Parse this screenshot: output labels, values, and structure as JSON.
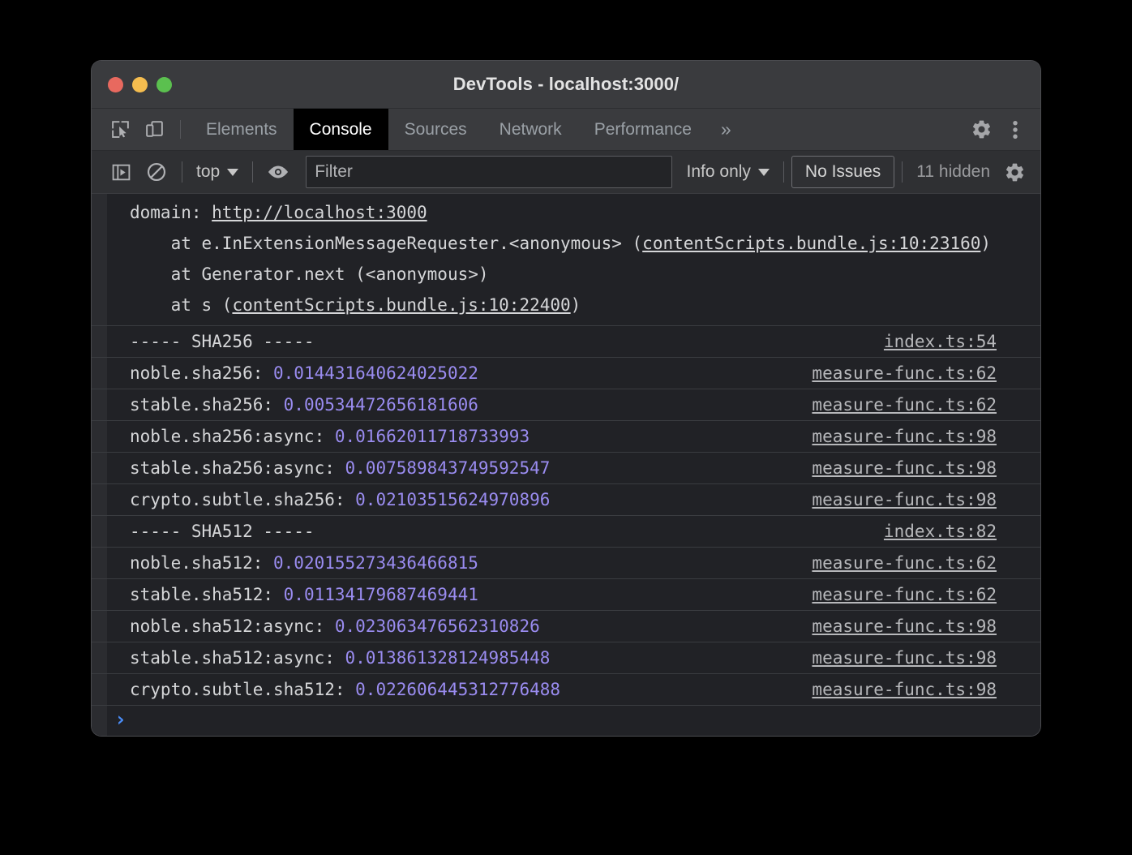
{
  "window": {
    "title": "DevTools - localhost:3000/",
    "traffic_lights": [
      {
        "name": "close",
        "color": "#e8695f"
      },
      {
        "name": "minimize",
        "color": "#f5bd4f"
      },
      {
        "name": "maximize",
        "color": "#5bc04f"
      }
    ]
  },
  "tab_bar": {
    "inspect_icon": "inspect-element-icon",
    "device_icon": "device-toolbar-icon",
    "tabs": [
      {
        "label": "Elements",
        "active": false
      },
      {
        "label": "Console",
        "active": true
      },
      {
        "label": "Sources",
        "active": false
      },
      {
        "label": "Network",
        "active": false
      },
      {
        "label": "Performance",
        "active": false
      }
    ],
    "overflow_label": "»",
    "settings_icon": "gear-icon",
    "more_icon": "kebab-menu-icon"
  },
  "console_toolbar": {
    "sidebar_toggle_icon": "console-sidebar-toggle-icon",
    "clear_icon": "clear-console-icon",
    "context_selector": "top",
    "eye_icon": "live-expression-eye-icon",
    "filter": {
      "placeholder": "Filter",
      "value": ""
    },
    "level_selector": "Info only",
    "issues_button": "No Issues",
    "hidden_count": "11 hidden",
    "settings_icon": "console-settings-gear-icon"
  },
  "console": {
    "stack_block": {
      "line1_label": "domain: ",
      "line1_link": "http://localhost:3000",
      "line2_prefix": "    at e.InExtensionMessageRequester.<anonymous> (",
      "line2_link": "contentScripts.bundle.js:10:23160",
      "line2_suffix": ")",
      "line3": "    at Generator.next (<anonymous>)",
      "line4_prefix": "    at s (",
      "line4_link": "contentScripts.bundle.js:10:22400",
      "line4_suffix": ")"
    },
    "rows": [
      {
        "label": "----- SHA256 -----",
        "value": "",
        "source": "index.ts:54"
      },
      {
        "label": "noble.sha256: ",
        "value": "0.014431640624025022",
        "source": "measure-func.ts:62"
      },
      {
        "label": "stable.sha256: ",
        "value": "0.00534472656181606",
        "source": "measure-func.ts:62"
      },
      {
        "label": "noble.sha256:async: ",
        "value": "0.01662011718733993",
        "source": "measure-func.ts:98"
      },
      {
        "label": "stable.sha256:async: ",
        "value": "0.007589843749592547",
        "source": "measure-func.ts:98"
      },
      {
        "label": "crypto.subtle.sha256: ",
        "value": "0.02103515624970896",
        "source": "measure-func.ts:98"
      },
      {
        "label": "----- SHA512 -----",
        "value": "",
        "source": "index.ts:82"
      },
      {
        "label": "noble.sha512: ",
        "value": "0.020155273436466815",
        "source": "measure-func.ts:62"
      },
      {
        "label": "stable.sha512: ",
        "value": "0.01134179687469441",
        "source": "measure-func.ts:62"
      },
      {
        "label": "noble.sha512:async: ",
        "value": "0.023063476562310826",
        "source": "measure-func.ts:98"
      },
      {
        "label": "stable.sha512:async: ",
        "value": "0.013861328124985448",
        "source": "measure-func.ts:98"
      },
      {
        "label": "crypto.subtle.sha512: ",
        "value": "0.022606445312776488",
        "source": "measure-func.ts:98"
      }
    ],
    "prompt": {
      "chevron": "›",
      "value": "",
      "chevron_color": "#4a8df8"
    }
  },
  "colors": {
    "window_bg": "#202124",
    "titlebar_bg": "#3a3b3e",
    "toolbar_bg": "#2f3033",
    "console_bg": "#212226",
    "row_separator": "#3a3c40",
    "text": "#d5d6d8",
    "number": "#9a8cf0",
    "link": "#b7b8bb",
    "accent_blue": "#4a8df8"
  }
}
